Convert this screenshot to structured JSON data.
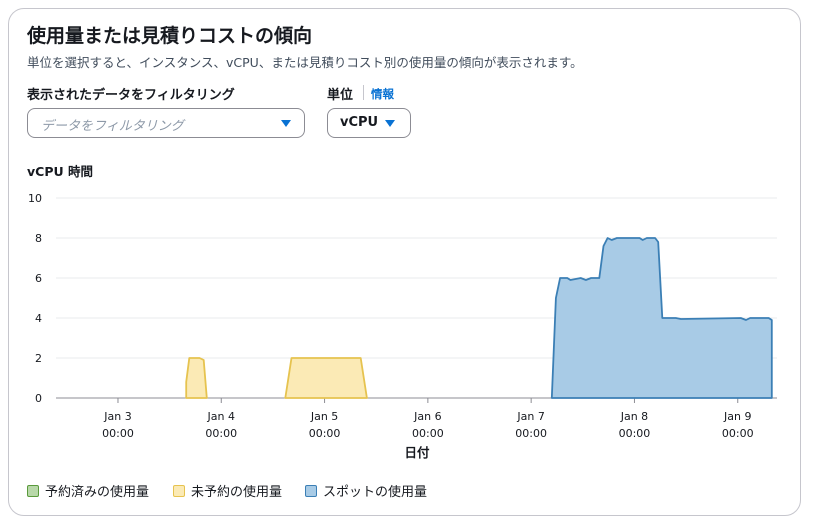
{
  "widget": {
    "title": "使用量または見積りコストの傾向",
    "description": "単位を選択すると、インスタンス、vCPU、または見積りコスト別の使用量の傾向が表示されます。"
  },
  "filter": {
    "label": "表示されたデータをフィルタリング",
    "placeholder": "データをフィルタリング"
  },
  "unit": {
    "label": "単位",
    "info_link": "情報",
    "selected": "vCPU"
  },
  "colors": {
    "reserved_fill": "#b8d8a9",
    "reserved_line": "#5a9a3c",
    "ondemand_fill": "#fbeab5",
    "ondemand_line": "#e6c34f",
    "spot_fill": "#a8cbe6",
    "spot_line": "#3b7fb5"
  },
  "chart_data": {
    "type": "area",
    "title": "vCPU 時間",
    "xlabel": "日付",
    "ylabel": "vCPU 時間",
    "ylim": [
      0,
      10
    ],
    "yticks": [
      "0",
      "2",
      "4",
      "6",
      "8",
      "10"
    ],
    "xticks": [
      {
        "x": 3.0,
        "date": "Jan 3",
        "time": "00:00"
      },
      {
        "x": 4.0,
        "date": "Jan 4",
        "time": "00:00"
      },
      {
        "x": 5.0,
        "date": "Jan 5",
        "time": "00:00"
      },
      {
        "x": 6.0,
        "date": "Jan 6",
        "time": "00:00"
      },
      {
        "x": 7.0,
        "date": "Jan 7",
        "time": "00:00"
      },
      {
        "x": 8.0,
        "date": "Jan 8",
        "time": "00:00"
      },
      {
        "x": 9.0,
        "date": "Jan 9",
        "time": "00:00"
      }
    ],
    "xlim": [
      2.4,
      9.38
    ],
    "grid": true,
    "legend_position": "bottom-left",
    "series": [
      {
        "name": "予約済みの使用量",
        "points": []
      },
      {
        "name": "未予約の使用量",
        "points": [
          [
            3.66,
            0
          ],
          [
            3.66,
            0.8
          ],
          [
            3.69,
            2.0
          ],
          [
            3.79,
            2.0
          ],
          [
            3.83,
            1.9
          ],
          [
            3.86,
            0
          ],
          [
            4.62,
            0
          ],
          [
            4.68,
            2.0
          ],
          [
            5.35,
            2.0
          ],
          [
            5.41,
            0
          ]
        ]
      },
      {
        "name": "スポットの使用量",
        "points": [
          [
            7.2,
            0
          ],
          [
            7.24,
            5.0
          ],
          [
            7.28,
            6.0
          ],
          [
            7.35,
            6.0
          ],
          [
            7.38,
            5.9
          ],
          [
            7.48,
            6.0
          ],
          [
            7.53,
            5.9
          ],
          [
            7.58,
            6.0
          ],
          [
            7.66,
            6.0
          ],
          [
            7.7,
            7.6
          ],
          [
            7.74,
            8.0
          ],
          [
            7.78,
            7.9
          ],
          [
            7.83,
            8.0
          ],
          [
            8.05,
            8.0
          ],
          [
            8.08,
            7.9
          ],
          [
            8.12,
            8.0
          ],
          [
            8.2,
            8.0
          ],
          [
            8.23,
            7.8
          ],
          [
            8.27,
            4.0
          ],
          [
            8.4,
            4.0
          ],
          [
            8.45,
            3.95
          ],
          [
            9.03,
            4.0
          ],
          [
            9.08,
            3.9
          ],
          [
            9.12,
            4.0
          ],
          [
            9.3,
            4.0
          ],
          [
            9.33,
            3.9
          ],
          [
            9.33,
            0
          ]
        ]
      }
    ]
  }
}
